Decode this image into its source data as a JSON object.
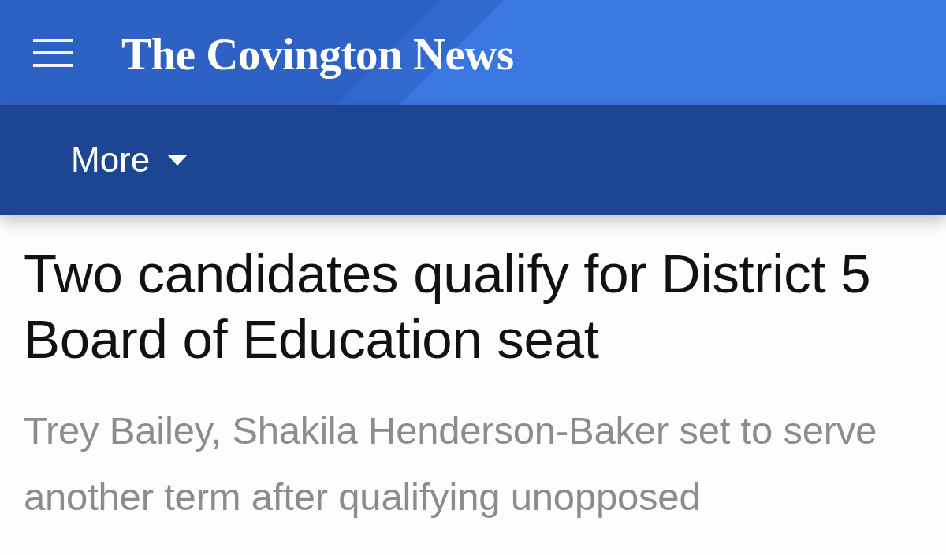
{
  "header": {
    "logo": "The Covington News"
  },
  "nav": {
    "menu_label": "More"
  },
  "article": {
    "headline": "Two candidates qualify for District 5 Board of Education seat",
    "subheadline": "Trey Bailey, Shakila Henderson-Baker set to serve another term after qualifying unopposed"
  }
}
